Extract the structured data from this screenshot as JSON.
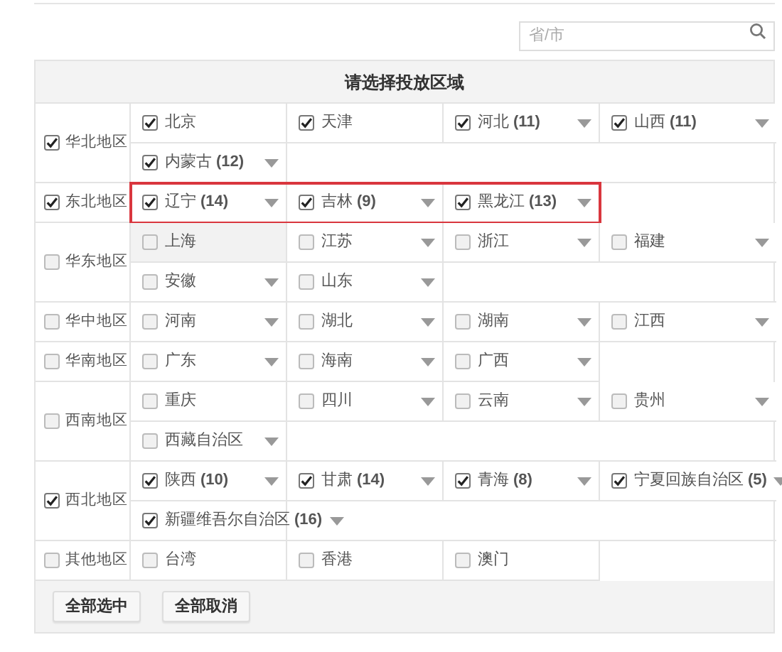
{
  "search": {
    "placeholder": "省/市"
  },
  "table": {
    "title": "请选择投放区域",
    "regions": [
      {
        "label": "华北地区",
        "checked": true,
        "outlined": false,
        "provinces": [
          {
            "label": "北京",
            "checked": true,
            "dropdown": false,
            "highlighted": false
          },
          {
            "label": "天津",
            "checked": true,
            "dropdown": false,
            "highlighted": false
          },
          {
            "label": "河北",
            "count": "(11)",
            "checked": true,
            "dropdown": true,
            "highlighted": false
          },
          {
            "label": "山西",
            "count": "(11)",
            "checked": true,
            "dropdown": true,
            "highlighted": false
          },
          {
            "label": "内蒙古",
            "count": "(12)",
            "checked": true,
            "dropdown": true,
            "highlighted": false
          }
        ]
      },
      {
        "label": "东北地区",
        "checked": true,
        "outlined": true,
        "provinces": [
          {
            "label": "辽宁",
            "count": "(14)",
            "checked": true,
            "dropdown": true,
            "highlighted": false
          },
          {
            "label": "吉林",
            "count": "(9)",
            "checked": true,
            "dropdown": true,
            "highlighted": false
          },
          {
            "label": "黑龙江",
            "count": "(13)",
            "checked": true,
            "dropdown": true,
            "highlighted": false
          }
        ]
      },
      {
        "label": "华东地区",
        "checked": false,
        "outlined": false,
        "provinces": [
          {
            "label": "上海",
            "checked": false,
            "dropdown": false,
            "highlighted": true
          },
          {
            "label": "江苏",
            "checked": false,
            "dropdown": true,
            "highlighted": false
          },
          {
            "label": "浙江",
            "checked": false,
            "dropdown": true,
            "highlighted": false
          },
          {
            "label": "福建",
            "checked": false,
            "dropdown": true,
            "highlighted": false
          },
          {
            "label": "安徽",
            "checked": false,
            "dropdown": true,
            "highlighted": false
          },
          {
            "label": "山东",
            "checked": false,
            "dropdown": true,
            "highlighted": false
          }
        ]
      },
      {
        "label": "华中地区",
        "checked": false,
        "outlined": false,
        "provinces": [
          {
            "label": "河南",
            "checked": false,
            "dropdown": true,
            "highlighted": false
          },
          {
            "label": "湖北",
            "checked": false,
            "dropdown": true,
            "highlighted": false
          },
          {
            "label": "湖南",
            "checked": false,
            "dropdown": true,
            "highlighted": false
          },
          {
            "label": "江西",
            "checked": false,
            "dropdown": true,
            "highlighted": false
          }
        ]
      },
      {
        "label": "华南地区",
        "checked": false,
        "outlined": false,
        "provinces": [
          {
            "label": "广东",
            "checked": false,
            "dropdown": true,
            "highlighted": false
          },
          {
            "label": "海南",
            "checked": false,
            "dropdown": true,
            "highlighted": false
          },
          {
            "label": "广西",
            "checked": false,
            "dropdown": true,
            "highlighted": false
          }
        ]
      },
      {
        "label": "西南地区",
        "checked": false,
        "outlined": false,
        "provinces": [
          {
            "label": "重庆",
            "checked": false,
            "dropdown": false,
            "highlighted": false
          },
          {
            "label": "四川",
            "checked": false,
            "dropdown": true,
            "highlighted": false
          },
          {
            "label": "云南",
            "checked": false,
            "dropdown": true,
            "highlighted": false
          },
          {
            "label": "贵州",
            "checked": false,
            "dropdown": true,
            "highlighted": false
          },
          {
            "label": "西藏自治区",
            "checked": false,
            "dropdown": true,
            "highlighted": false
          }
        ]
      },
      {
        "label": "西北地区",
        "checked": true,
        "outlined": false,
        "provinces": [
          {
            "label": "陕西",
            "count": "(10)",
            "checked": true,
            "dropdown": true,
            "highlighted": false
          },
          {
            "label": "甘肃",
            "count": "(14)",
            "checked": true,
            "dropdown": true,
            "highlighted": false
          },
          {
            "label": "青海",
            "count": "(8)",
            "checked": true,
            "dropdown": true,
            "highlighted": false
          },
          {
            "label": "宁夏回族自治区",
            "count": "(5)",
            "checked": true,
            "dropdown": true,
            "highlighted": false
          },
          {
            "label": "新疆维吾尔自治区",
            "count": "(16)",
            "checked": true,
            "dropdown": true,
            "highlighted": false
          }
        ]
      },
      {
        "label": "其他地区",
        "checked": false,
        "outlined": false,
        "provinces": [
          {
            "label": "台湾",
            "checked": false,
            "dropdown": false,
            "highlighted": false
          },
          {
            "label": "香港",
            "checked": false,
            "dropdown": false,
            "highlighted": false
          },
          {
            "label": "澳门",
            "checked": false,
            "dropdown": false,
            "highlighted": false
          }
        ]
      }
    ]
  },
  "buttons": [
    "全部选中",
    "全部取消"
  ]
}
